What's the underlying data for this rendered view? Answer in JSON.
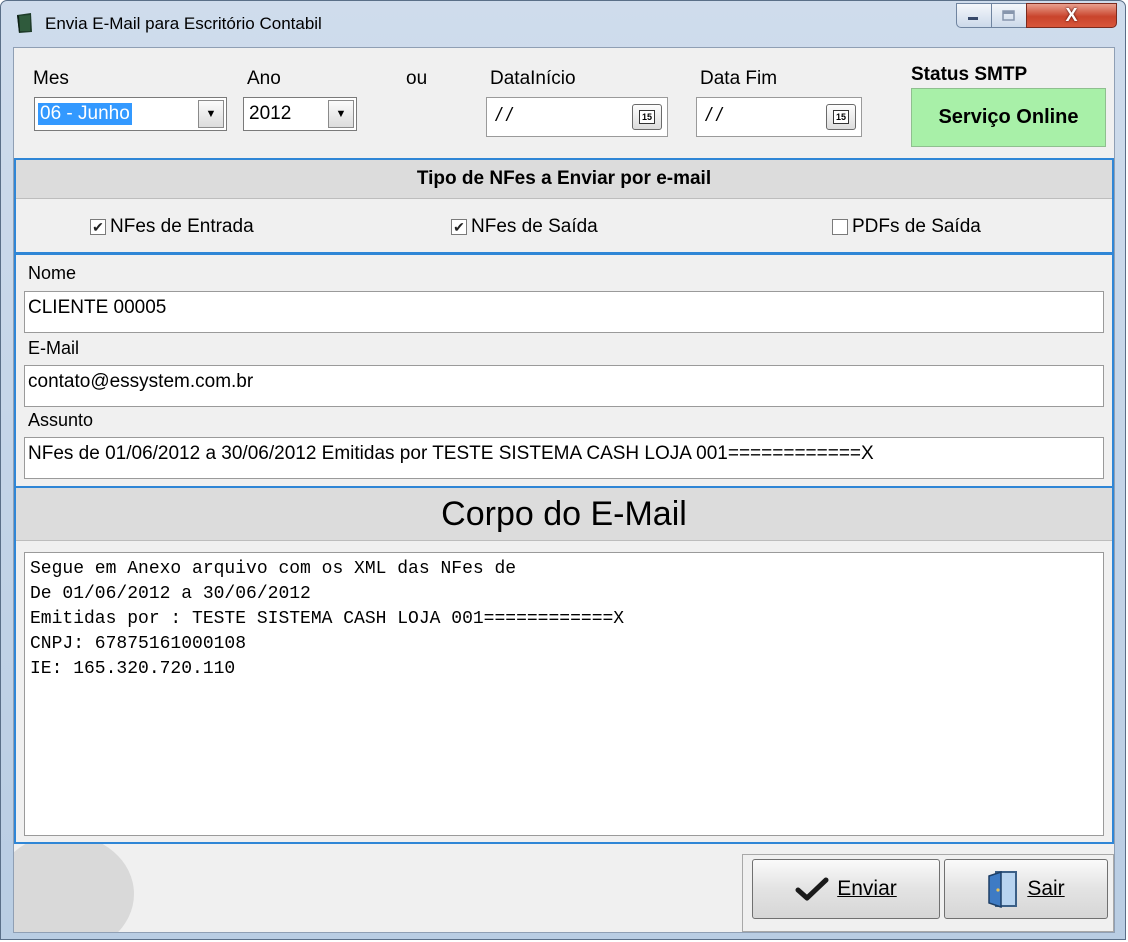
{
  "window": {
    "title": "Envia E-Mail para Escritório Contabil",
    "close_label": "X"
  },
  "filters": {
    "mes_label": "Mes",
    "mes_value": "06 - Junho",
    "ano_label": "Ano",
    "ano_value": "2012",
    "ou_label": "ou",
    "data_inicio_label": "DataInício",
    "data_inicio_value": "/ /",
    "data_fim_label": "Data Fim",
    "data_fim_value": "/ /",
    "calendar_day": "15"
  },
  "status": {
    "title": "Status SMTP",
    "value": "Serviço Online",
    "color": "#a8f0a8"
  },
  "tipo": {
    "header": "Tipo de NFes a Enviar por e-mail",
    "options": [
      {
        "label": "NFes de Entrada",
        "checked": true
      },
      {
        "label": "NFes de Saída",
        "checked": true
      },
      {
        "label": "PDFs de Saída",
        "checked": false
      }
    ]
  },
  "form": {
    "nome_label": "Nome",
    "nome_value": "CLIENTE 00005",
    "email_label": "E-Mail",
    "email_value": "contato@essystem.com.br",
    "assunto_label": "Assunto",
    "assunto_value": "NFes de 01/06/2012 a 30/06/2012 Emitidas por TESTE SISTEMA CASH LOJA 001============X"
  },
  "corpo": {
    "header": "Corpo do E-Mail",
    "lines": [
      "Segue em Anexo arquivo com os XML das NFes de",
      "De 01/06/2012 a 30/06/2012",
      "Emitidas por : TESTE SISTEMA CASH LOJA 001============X",
      "CNPJ: 67875161000108",
      "IE: 165.320.720.110"
    ]
  },
  "actions": {
    "enviar_label": "Enviar",
    "sair_label": "Sair"
  }
}
